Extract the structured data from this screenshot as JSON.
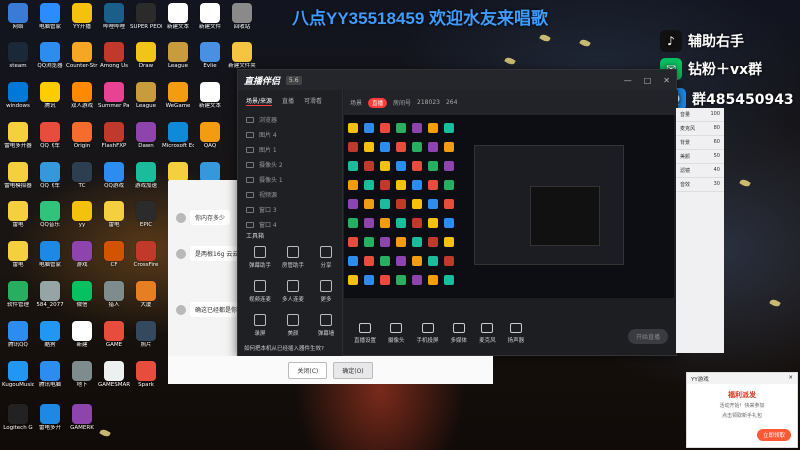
{
  "banner": "八点YY35518459 欢迎水友来唱歌",
  "promo": {
    "line1": "辅助右手",
    "line2": "钻粉＋vx群",
    "line3": "群485450943"
  },
  "desktop_icons": [
    {
      "label": "网络",
      "color": "#3a7bd5"
    },
    {
      "label": "电脑管家",
      "color": "#2a8cff"
    },
    {
      "label": "YY开播",
      "color": "#f4c20d"
    },
    {
      "label": "哔哩哔哩",
      "color": "#1a5f8a"
    },
    {
      "label": "SUPER PEOPLE",
      "color": "#2b2b2b"
    },
    {
      "label": "新建文本",
      "color": "#ffffff"
    },
    {
      "label": "新建文件",
      "color": "#ffffff"
    },
    {
      "label": "回收站",
      "color": "#8a8a8a"
    },
    {
      "label": "steam",
      "color": "#1b2838"
    },
    {
      "label": "QQ浏览器",
      "color": "#2d8cf0"
    },
    {
      "label": "Counter-Strike",
      "color": "#f5a623"
    },
    {
      "label": "Among Us",
      "color": "#c0392b"
    },
    {
      "label": "Draw",
      "color": "#f0c419"
    },
    {
      "label": "League",
      "color": "#c89b3c"
    },
    {
      "label": "Evlie",
      "color": "#4a90e2"
    },
    {
      "label": "新建文件夹",
      "color": "#f5c542"
    },
    {
      "label": "windows",
      "color": "#0078d7"
    },
    {
      "label": "腾讯",
      "color": "#ffcc00"
    },
    {
      "label": "双人游戏",
      "color": "#ff8a00"
    },
    {
      "label": "Summer Party",
      "color": "#e84393"
    },
    {
      "label": "League",
      "color": "#c89b3c"
    },
    {
      "label": "WeGame",
      "color": "#f39c12"
    },
    {
      "label": "新建文本",
      "color": "#ffffff"
    },
    {
      "label": "雷电多开器",
      "color": "#f4d03f"
    },
    {
      "label": "QQ飞车",
      "color": "#e74c3c"
    },
    {
      "label": "Origin",
      "color": "#f56c2d"
    },
    {
      "label": "FlashFXP",
      "color": "#c0392b"
    },
    {
      "label": "Dawn",
      "color": "#8e44ad"
    },
    {
      "label": "Microsoft Edge",
      "color": "#0f8ad8"
    },
    {
      "label": "QAQ",
      "color": "#f39c12"
    },
    {
      "label": "雷电模拟器",
      "color": "#f4d03f"
    },
    {
      "label": "QQ飞车",
      "color": "#3498db"
    },
    {
      "label": "TC",
      "color": "#2c3e50"
    },
    {
      "label": "QQ游戏",
      "color": "#2d8cf0"
    },
    {
      "label": "游戏加速",
      "color": "#1abc9c"
    },
    {
      "label": "雷电",
      "color": "#f4d03f"
    },
    {
      "label": "ThunderBird",
      "color": "#3498db"
    },
    {
      "label": "雷电",
      "color": "#f4d03f"
    },
    {
      "label": "QQ音乐",
      "color": "#31c27c"
    },
    {
      "label": "yy",
      "color": "#f4c20d"
    },
    {
      "label": "雷电",
      "color": "#f4d03f"
    },
    {
      "label": "EPIC",
      "color": "#2b2b2b"
    },
    {
      "label": "雷电",
      "color": "#f4d03f"
    },
    {
      "label": "电脑管家",
      "color": "#1e88e5"
    },
    {
      "label": "游戏",
      "color": "#8e44ad"
    },
    {
      "label": "CF",
      "color": "#d35400"
    },
    {
      "label": "CrossFire",
      "color": "#c0392b"
    },
    {
      "label": "软件管理",
      "color": "#27ae60"
    },
    {
      "label": "584_2077",
      "color": "#95a5a6"
    },
    {
      "label": "微信",
      "color": "#07c160"
    },
    {
      "label": "猎人",
      "color": "#7f8c8d"
    },
    {
      "label": "大厦",
      "color": "#e67e22"
    },
    {
      "label": "腾讯QQ",
      "color": "#2d8cf0"
    },
    {
      "label": "酷狗",
      "color": "#2196f3"
    },
    {
      "label": "新建",
      "color": "#ffffff"
    },
    {
      "label": "GAME",
      "color": "#e74c3c"
    },
    {
      "label": "照片",
      "color": "#34495e"
    },
    {
      "label": "KugouMusic",
      "color": "#2196f3"
    },
    {
      "label": "腾讯电脑",
      "color": "#2d8cf0"
    },
    {
      "label": "地下",
      "color": "#7f8c8d"
    },
    {
      "label": "GAMESMARKET",
      "color": "#ecf0f1"
    },
    {
      "label": "Spark",
      "color": "#e74c3c"
    },
    {
      "label": "Logitech G",
      "color": "#222222"
    },
    {
      "label": "雷电多开",
      "color": "#1e88e5"
    },
    {
      "label": "GAMERK",
      "color": "#8e44ad"
    }
  ],
  "chat": {
    "messages": [
      "你内存多少",
      "是两根16g 云云",
      "确这已经都是你"
    ]
  },
  "app": {
    "title": "直播伴侣",
    "version": "5.6",
    "side_tabs": [
      "场景/来源",
      "直播",
      "可滑看"
    ],
    "sources": [
      "浏览器",
      "图片 4",
      "图片 1",
      "摄像头 2",
      "摄像头 1",
      "视频源",
      "窗口 3",
      "窗口 4"
    ],
    "tools_title": "工具箱",
    "tools": [
      "弹幕助手",
      "房管助手",
      "分享",
      "视频连麦",
      "多人连麦",
      "更多",
      "录屏",
      "美颜",
      "弹幕墙"
    ],
    "audio_link": "如何把本机从已经插入器件生效?",
    "topbar": {
      "scene": "场景",
      "pill": "直播",
      "room": "房间号",
      "rank": "218023",
      "viewers": "264"
    },
    "bottom": [
      "直播设置",
      "摄像头",
      "手机投屏",
      "多媒体",
      "麦克风",
      "扬声器"
    ],
    "start": "开始直播"
  },
  "rpanel": {
    "rows": [
      [
        "音量",
        "100"
      ],
      [
        "麦克风",
        "80"
      ],
      [
        "背景",
        "60"
      ],
      [
        "美颜",
        "50"
      ],
      [
        "滤镜",
        "40"
      ],
      [
        "音效",
        "30"
      ]
    ]
  },
  "dialog": {
    "cancel": "关闭(C)",
    "ok": "确定(O)"
  },
  "popup": {
    "header": "YY游戏",
    "title": "福利派发",
    "line1": "活动开始！快来参加",
    "line2": "点击领取新手礼包",
    "button": "立即领取"
  }
}
